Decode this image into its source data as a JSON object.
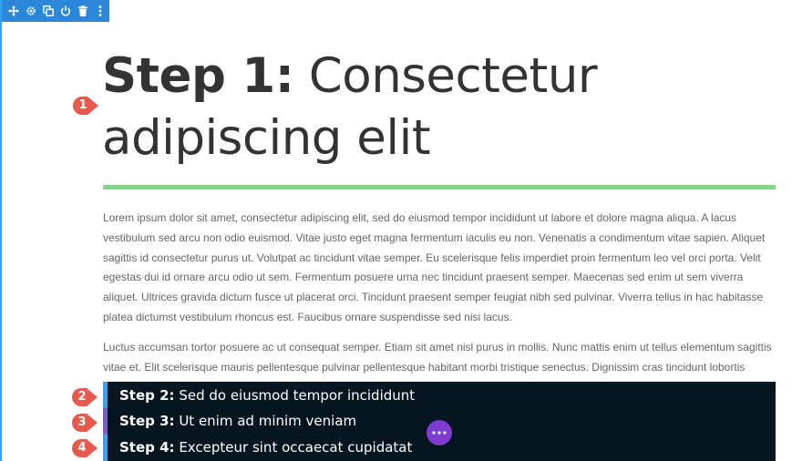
{
  "toolbar": {
    "icons": [
      "move-icon",
      "gear-icon",
      "duplicate-icon",
      "power-icon",
      "trash-icon",
      "more-vertical-icon"
    ]
  },
  "heading": {
    "bold": "Step 1:",
    "rest": " Consectetur adipiscing elit"
  },
  "body": {
    "paragraph1": "Lorem ipsum dolor sit amet, consectetur adipiscing elit, sed do eiusmod tempor incididunt ut labore et dolore magna aliqua. A lacus vestibulum sed arcu non odio euismod. Vitae justo eget magna fermentum iaculis eu non. Venenatis a condimentum vitae sapien. Aliquet sagittis id consectetur purus ut. Volutpat ac tincidunt vitae semper. Eu scelerisque felis imperdiet proin fermentum leo vel orci porta. Velit egestas dui id ornare arcu odio ut sem. Fermentum posuere urna nec tincidunt praesent semper. Maecenas sed enim ut sem viverra aliquet. Ultrices gravida dictum fusce ut placerat orci. Tincidunt praesent semper feugiat nibh sed pulvinar. Viverra tellus in hac habitasse platea dictumst vestibulum rhoncus est. Faucibus ornare suspendisse sed nisi lacus.",
    "paragraph2": "Luctus accumsan tortor posuere ac ut consequat semper. Etiam sit amet nisl purus in mollis. Nunc mattis enim ut tellus elementum sagittis vitae et. Elit scelerisque mauris pellentesque pulvinar pellentesque habitant morbi tristique senectus. Dignissim cras tincidunt lobortis feugiat vivamus"
  },
  "steps": [
    {
      "label": "Step 2:",
      "text": " Sed do eiusmod tempor incididunt"
    },
    {
      "label": "Step 3:",
      "text": " Ut enim ad minim veniam"
    },
    {
      "label": "Step 4:",
      "text": " Excepteur sint occaecat cupidatat"
    }
  ],
  "badges": [
    "1",
    "2",
    "3",
    "4"
  ],
  "colors": {
    "toolbar": "#2b87da",
    "divider": "#7cda80",
    "band": "#061620",
    "badge": "#e8584d",
    "more": "#7e3bd0"
  }
}
